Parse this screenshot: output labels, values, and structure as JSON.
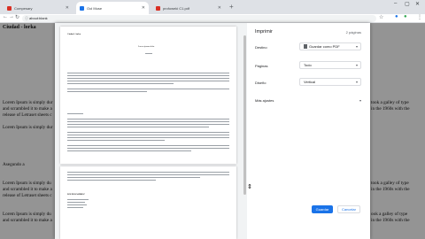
{
  "browser": {
    "tabs": [
      {
        "label": "Compesary",
        "fav_color": "#d93025"
      },
      {
        "label": "Ool Muse",
        "fav_color": "#1a73e8"
      },
      {
        "label": "profoweki C1.pdf",
        "fav_color": "#d93025"
      }
    ],
    "new_tab": "+",
    "win_min": "–",
    "win_max": "▢",
    "win_close": "✕",
    "address": "about:blank",
    "back": "←",
    "forward": "→",
    "reload": "↻",
    "lock": "ⓘ",
    "star": "☆",
    "menu": "⋮",
    "ext1": "●",
    "ext2": "●"
  },
  "background": {
    "title": "Ciudad - lorka",
    "left_lines": [
      "Lorem Ipsum is simply dur",
      "and scrambled it to make a",
      "release of Letraset sheets c",
      "",
      "Lorem Ipsum is simply dur"
    ],
    "right_lines": [
      "took a galley of type",
      "in the 1960s with the",
      "",
      ""
    ],
    "section": "Asegundo a",
    "bottom_left": [
      "Lorem Ipsum is simply du",
      "and scrambled it to make a",
      "release of Letraset sheets c",
      "",
      "Lorem Ipsum is simply du",
      "and scrambled it to make a"
    ],
    "bottom_right": [
      "took a galley of type",
      "in the 1960s with the",
      "",
      "",
      "ook a galley of type",
      "in the 1960s with the"
    ]
  },
  "print": {
    "title": "Imprimir",
    "pages_count": "2 páginas",
    "destination_label": "Destino",
    "destination_value": "Guardar como PDF",
    "pages_label": "Páginas",
    "pages_value": "Todo",
    "layout_label": "Diseño",
    "layout_value": "Vertical",
    "more_settings": "Más ajustes",
    "save_button": "Guardar",
    "cancel_button": "Cancelar"
  },
  "preview": {
    "page1_title": "Ciudad - lorka",
    "page1_heading": "Lorem ipsum dolor",
    "page2_name": "DAVID RAMIREZ"
  }
}
